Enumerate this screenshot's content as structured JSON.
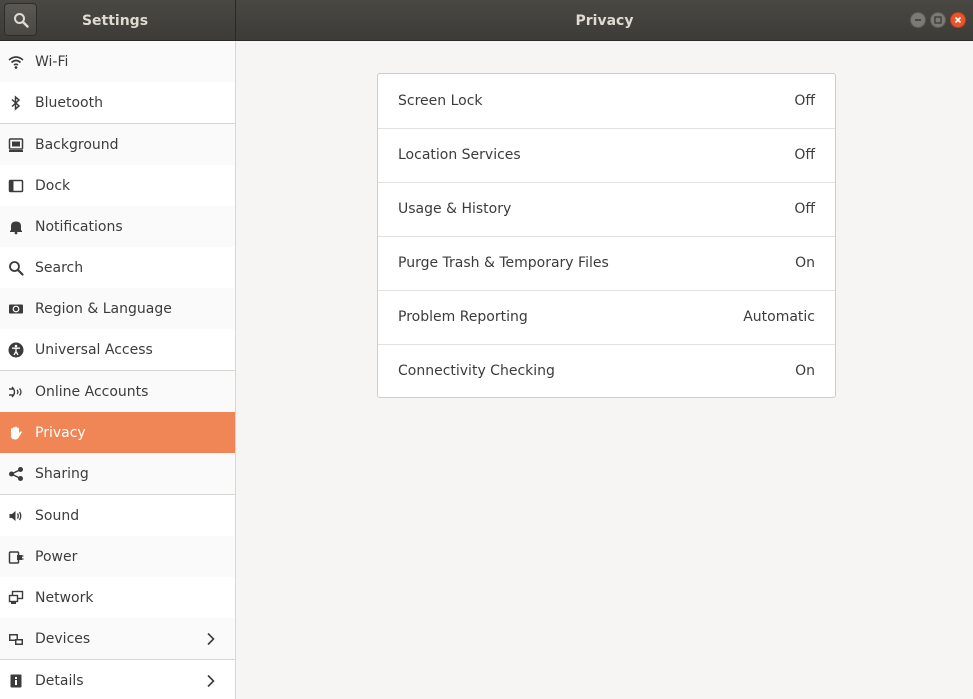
{
  "window": {
    "sidebar_title": "Settings",
    "page_title": "Privacy"
  },
  "sidebar": {
    "items": [
      {
        "label": "Wi-Fi",
        "icon": "wifi-icon"
      },
      {
        "label": "Bluetooth",
        "icon": "bluetooth-icon"
      },
      {
        "label": "Background",
        "icon": "background-icon"
      },
      {
        "label": "Dock",
        "icon": "dock-icon"
      },
      {
        "label": "Notifications",
        "icon": "bell-icon"
      },
      {
        "label": "Search",
        "icon": "search-icon"
      },
      {
        "label": "Region & Language",
        "icon": "region-icon"
      },
      {
        "label": "Universal Access",
        "icon": "accessibility-icon"
      },
      {
        "label": "Online Accounts",
        "icon": "online-accounts-icon"
      },
      {
        "label": "Privacy",
        "icon": "hand-icon"
      },
      {
        "label": "Sharing",
        "icon": "share-icon"
      },
      {
        "label": "Sound",
        "icon": "speaker-icon"
      },
      {
        "label": "Power",
        "icon": "power-plug-icon"
      },
      {
        "label": "Network",
        "icon": "network-icon"
      },
      {
        "label": "Devices",
        "icon": "devices-icon"
      },
      {
        "label": "Details",
        "icon": "info-icon"
      }
    ],
    "active_index": 9
  },
  "privacy": {
    "rows": [
      {
        "label": "Screen Lock",
        "value": "Off"
      },
      {
        "label": "Location Services",
        "value": "Off"
      },
      {
        "label": "Usage & History",
        "value": "Off"
      },
      {
        "label": "Purge Trash & Temporary Files",
        "value": "On"
      },
      {
        "label": "Problem Reporting",
        "value": "Automatic"
      },
      {
        "label": "Connectivity Checking",
        "value": "On"
      }
    ]
  },
  "colors": {
    "accent": "#f08556",
    "header": "#3d3b37",
    "close": "#e9552a"
  }
}
